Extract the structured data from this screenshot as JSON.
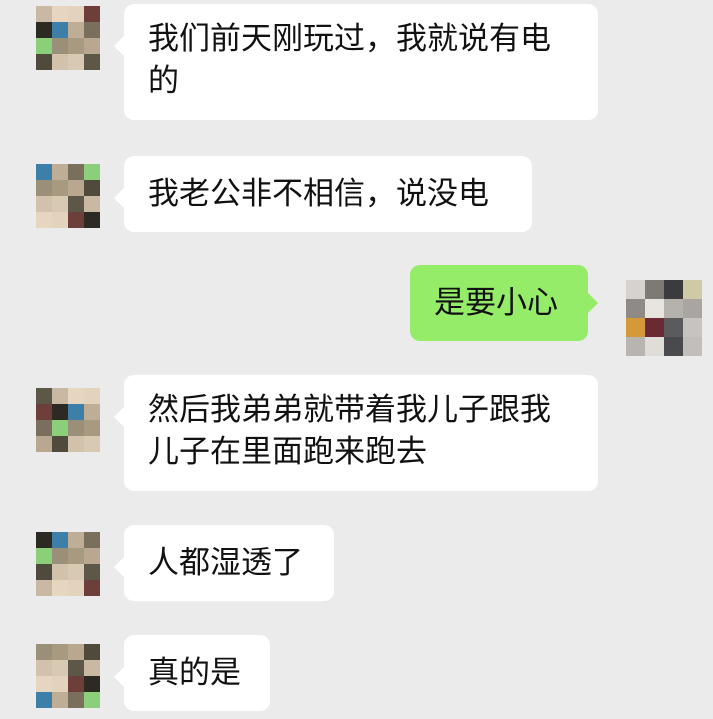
{
  "chat": {
    "messages": [
      {
        "side": "left",
        "lines": [
          "我们前天刚玩过，我就说有电",
          "的"
        ]
      },
      {
        "side": "left",
        "lines": [
          "我老公非不相信，说没电"
        ]
      },
      {
        "side": "right",
        "lines": [
          "是要小心"
        ]
      },
      {
        "side": "left",
        "lines": [
          "然后我弟弟就带着我儿子跟我",
          "儿子在里面跑来跑去"
        ]
      },
      {
        "side": "left",
        "lines": [
          "人都湿透了"
        ]
      },
      {
        "side": "left",
        "lines": [
          "真的是"
        ]
      }
    ]
  },
  "colors": {
    "background": "#ebebeb",
    "bubble_incoming": "#ffffff",
    "bubble_outgoing": "#95ec69"
  }
}
